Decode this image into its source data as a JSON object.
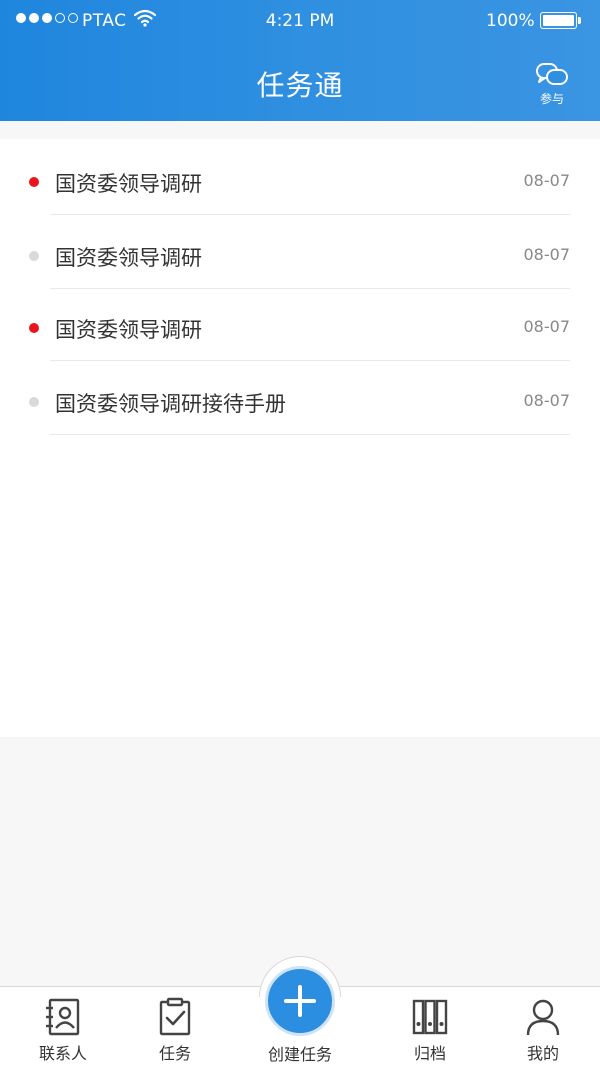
{
  "status_bar": {
    "carrier": "PTAC",
    "time": "4:21 PM",
    "battery": "100%",
    "signal_strength": 3
  },
  "nav": {
    "title": "任务通",
    "participate_label": "参与"
  },
  "tasks": [
    {
      "title": "国资委领导调研",
      "date": "08-07",
      "unread": true
    },
    {
      "title": "国资委领导调研",
      "date": "08-07",
      "unread": false
    },
    {
      "title": "国资委领导调研",
      "date": "08-07",
      "unread": true
    },
    {
      "title": "国资委领导调研接待手册",
      "date": "08-07",
      "unread": false
    }
  ],
  "tabbar": {
    "contacts": "联系人",
    "tasks": "任务",
    "create": "创建任务",
    "archive": "归档",
    "mine": "我的"
  },
  "colors": {
    "primary": "#2b8ee0",
    "unread_dot": "#e8161c",
    "read_dot": "#d9d9d9"
  }
}
